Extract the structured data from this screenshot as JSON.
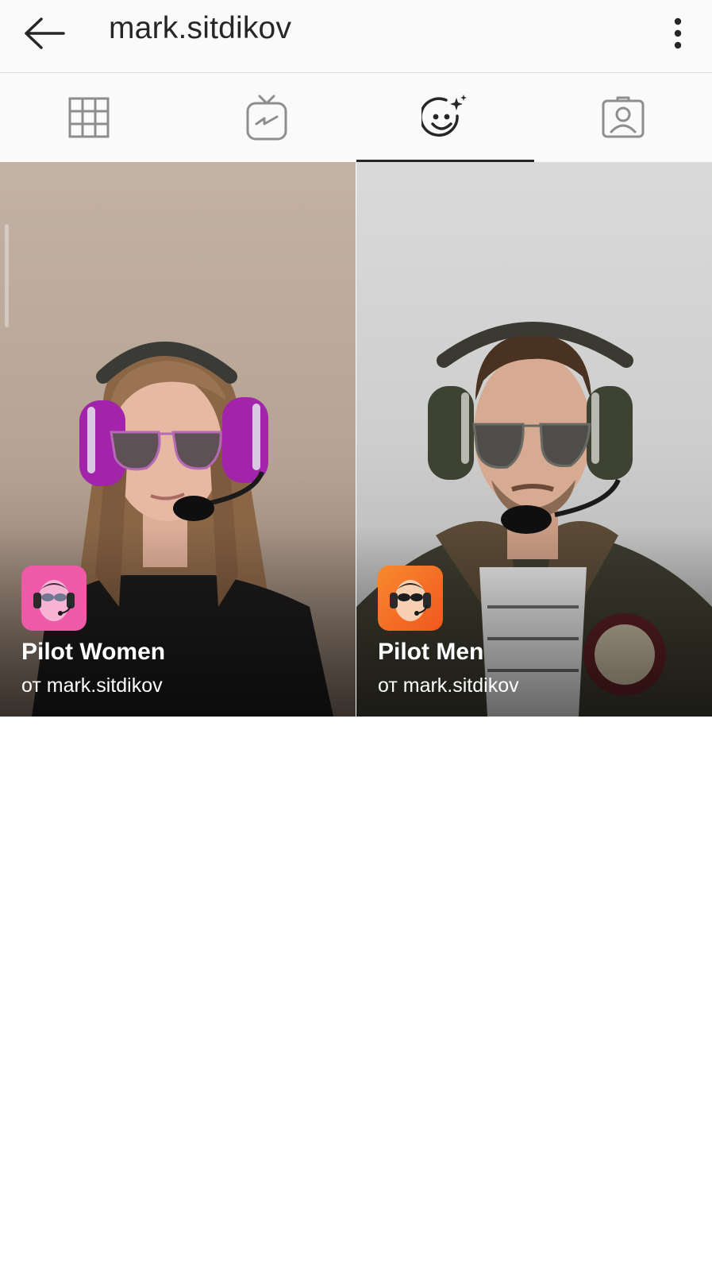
{
  "header": {
    "username": "mark.sitdikov",
    "back_icon": "arrow-left-icon",
    "more_icon": "more-vertical-icon"
  },
  "tabs": [
    {
      "name": "grid",
      "icon": "grid-icon",
      "active": false
    },
    {
      "name": "igtv",
      "icon": "igtv-icon",
      "active": false
    },
    {
      "name": "effects",
      "icon": "face-sparkle-icon",
      "active": true
    },
    {
      "name": "tagged",
      "icon": "tagged-person-icon",
      "active": false
    }
  ],
  "effects": [
    {
      "name": "Pilot Women",
      "author": "от mark.sitdikov",
      "icon_color": "#ee5aa8"
    },
    {
      "name": "Pilot Men",
      "author": "от mark.sitdikov",
      "icon_color": "#f46b27"
    }
  ],
  "colors": {
    "header_bg": "#fafafa",
    "text": "#262626",
    "icon_gray": "#8e8e8e"
  }
}
